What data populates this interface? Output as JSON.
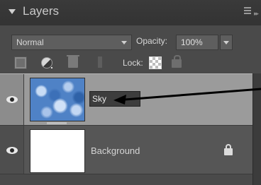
{
  "panel": {
    "title": "Layers"
  },
  "options": {
    "blend_mode": "Normal",
    "opacity_label": "Opacity:",
    "opacity_value": "100%",
    "lock_label": "Lock:"
  },
  "layers": [
    {
      "name": "Sky",
      "visible": true,
      "selected": true,
      "thumbnail": "sky-clouds"
    },
    {
      "name": "Background",
      "visible": true,
      "selected": false,
      "locked": true,
      "thumbnail": "white"
    }
  ],
  "icons": {
    "collapse": "triangle-down-icon",
    "panel_menu": "menu-lines-icon",
    "new_layer": "new-layer-icon",
    "adjustment": "adjustment-layer-icon",
    "delete": "trash-icon",
    "lock_transparency": "checkerboard-icon",
    "lock_all": "lock-icon",
    "visibility": "eye-icon"
  },
  "colors": {
    "panel_bg": "#4a4a4a",
    "selected_row": "#9b9b9b",
    "annotation_arrow": "#000000"
  }
}
